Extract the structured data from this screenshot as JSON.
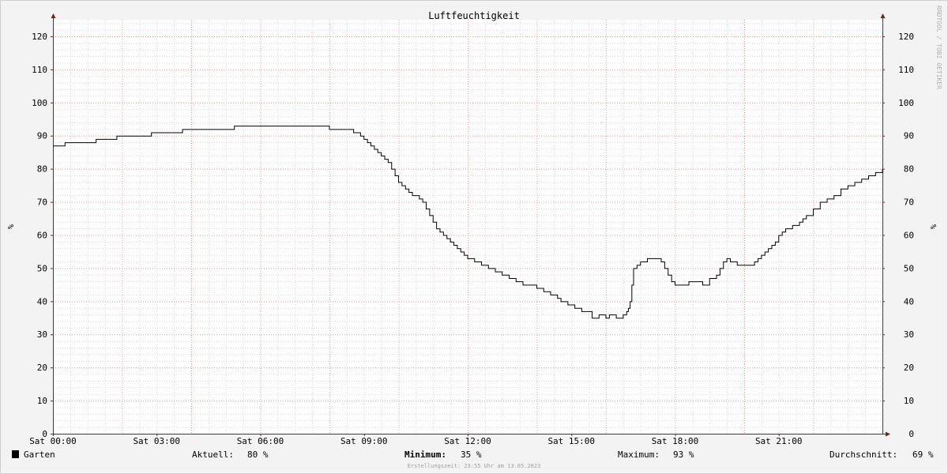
{
  "chart_data": {
    "type": "line",
    "title": "Luftfeuchtigkeit",
    "ylabel": "%",
    "ylim": [
      0,
      125
    ],
    "xlim_hours": [
      0,
      24
    ],
    "yticks": [
      0,
      10,
      20,
      30,
      40,
      50,
      60,
      70,
      80,
      90,
      100,
      110,
      120
    ],
    "xticks": [
      {
        "hour": 0,
        "label": "Sat 00:00"
      },
      {
        "hour": 3,
        "label": "Sat 03:00"
      },
      {
        "hour": 6,
        "label": "Sat 06:00"
      },
      {
        "hour": 9,
        "label": "Sat 09:00"
      },
      {
        "hour": 12,
        "label": "Sat 12:00"
      },
      {
        "hour": 15,
        "label": "Sat 15:00"
      },
      {
        "hour": 18,
        "label": "Sat 18:00"
      },
      {
        "hour": 21,
        "label": "Sat 21:00"
      }
    ],
    "grid": true,
    "series": [
      {
        "name": "Garten",
        "color": "#000000",
        "x": [
          0,
          0.3,
          0.35,
          1.2,
          1.25,
          1.8,
          1.85,
          2.8,
          2.85,
          3.7,
          3.75,
          5.2,
          5.25,
          7.9,
          8.0,
          8.5,
          8.7,
          8.9,
          9.0,
          9.1,
          9.2,
          9.3,
          9.4,
          9.5,
          9.6,
          9.7,
          9.8,
          9.9,
          10.0,
          10.1,
          10.2,
          10.3,
          10.4,
          10.5,
          10.6,
          10.7,
          10.8,
          10.9,
          11.0,
          11.1,
          11.2,
          11.3,
          11.4,
          11.5,
          11.6,
          11.7,
          11.8,
          11.9,
          12.0,
          12.2,
          12.4,
          12.6,
          12.8,
          13.0,
          13.2,
          13.4,
          13.6,
          13.8,
          14.0,
          14.1,
          14.2,
          14.3,
          14.4,
          14.5,
          14.6,
          14.7,
          14.9,
          15.1,
          15.3,
          15.6,
          15.8,
          15.9,
          16.0,
          16.1,
          16.3,
          16.5,
          16.6,
          16.65,
          16.7,
          16.75,
          16.8,
          16.9,
          17.0,
          17.2,
          17.4,
          17.6,
          17.7,
          17.8,
          17.9,
          18.0,
          18.2,
          18.4,
          18.6,
          18.8,
          19.0,
          19.2,
          19.3,
          19.4,
          19.5,
          19.6,
          19.8,
          20.0,
          20.2,
          20.3,
          20.4,
          20.5,
          20.6,
          20.7,
          20.8,
          20.9,
          21.0,
          21.1,
          21.2,
          21.4,
          21.6,
          21.7,
          21.8,
          22.0,
          22.2,
          22.4,
          22.6,
          22.8,
          23.0,
          23.2,
          23.4,
          23.6,
          23.8,
          24.0
        ],
        "values": [
          87,
          87,
          88,
          88,
          89,
          89,
          90,
          90,
          91,
          91,
          92,
          92,
          93,
          93,
          92,
          92,
          91,
          90,
          89,
          88,
          87,
          86,
          85,
          84,
          83,
          82,
          80,
          78,
          76,
          75,
          74,
          73,
          72,
          72,
          71,
          70,
          68,
          66,
          64,
          62,
          61,
          60,
          59,
          58,
          57,
          56,
          55,
          54,
          53,
          52,
          51,
          50,
          49,
          48,
          47,
          46,
          45,
          45,
          44,
          44,
          43,
          43,
          42,
          42,
          41,
          40,
          39,
          38,
          37,
          35,
          36,
          36,
          35,
          36,
          35,
          36,
          37,
          38,
          40,
          45,
          50,
          51,
          52,
          53,
          53,
          52,
          50,
          48,
          46,
          45,
          45,
          46,
          46,
          45,
          47,
          48,
          50,
          52,
          53,
          52,
          51,
          51,
          51,
          52,
          53,
          54,
          55,
          56,
          57,
          58,
          60,
          61,
          62,
          63,
          64,
          65,
          66,
          68,
          70,
          71,
          72,
          74,
          75,
          76,
          77,
          78,
          79,
          80
        ]
      }
    ]
  },
  "legend": {
    "series_name": "Garten",
    "aktuell_label": "Aktuell:",
    "aktuell_value": "80 %",
    "minimum_label": "Minimum:",
    "minimum_value": "35 %",
    "maximum_label": "Maximum:",
    "maximum_value": "93 %",
    "durchschnitt_label": "Durchschnitt:",
    "durchschnitt_value": "69 %"
  },
  "footer": {
    "erstellungszeit": "Erstellungszeit: 23:55 Uhr am 13.05.2023"
  },
  "watermark": "RRDTOOL / TOBI OETIKER",
  "colors": {
    "background": "#f3f3f3",
    "plot_background": "#ffffff",
    "major_grid": "#e8a0a0",
    "minor_grid": "#d8d8d8",
    "axis": "#7a2020",
    "line": "#000000"
  }
}
